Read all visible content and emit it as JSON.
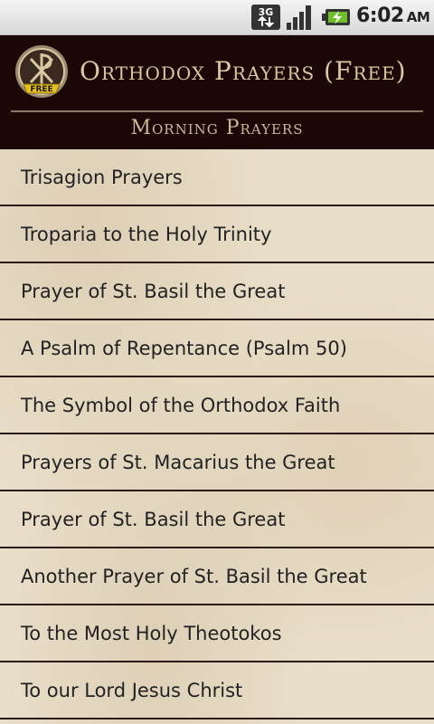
{
  "status_bar": {
    "network_label": "3G",
    "time": "6:02",
    "ampm": "AM"
  },
  "app": {
    "title": "Orthodox Prayers (Free)",
    "logo_badge": "FREE"
  },
  "section_title": "Morning Prayers",
  "items": [
    {
      "label": "Trisagion Prayers"
    },
    {
      "label": "Troparia to the Holy Trinity"
    },
    {
      "label": "Prayer of St. Basil the Great"
    },
    {
      "label": "A Psalm of Repentance (Psalm 50)"
    },
    {
      "label": "The Symbol of the Orthodox Faith"
    },
    {
      "label": "Prayers of St. Macarius the Great"
    },
    {
      "label": "Prayer of St. Basil the Great"
    },
    {
      "label": "Another Prayer of St. Basil the Great"
    },
    {
      "label": "To the Most Holy Theotokos"
    },
    {
      "label": "To our Lord Jesus Christ"
    }
  ]
}
